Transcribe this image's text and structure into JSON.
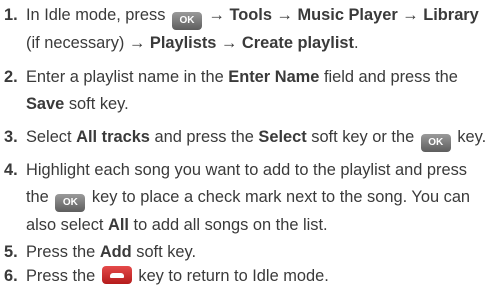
{
  "steps": [
    {
      "number": "1.",
      "parts": {
        "p1": "In Idle mode, press",
        "key": "OK",
        "a1": "→",
        "tools": "Tools",
        "a2": "→",
        "music_player": "Music Player",
        "a3": "→",
        "library": "Library",
        "if_necessary": "(if necessary)",
        "a4": "→",
        "playlists": "Playlists",
        "a5": "→",
        "create_playlist": "Create playlist",
        "end": "."
      }
    },
    {
      "number": "2.",
      "parts": {
        "p1": "Enter a playlist name in the",
        "enter_name": "Enter Name",
        "p2": "field and press the",
        "save": "Save",
        "p3": "soft key."
      }
    },
    {
      "number": "3.",
      "parts": {
        "p1": "Select",
        "all_tracks": "All tracks",
        "p2": "and press the",
        "select": "Select",
        "p3": "soft key or the",
        "key": "OK",
        "p4": "key."
      }
    },
    {
      "number": "4.",
      "parts": {
        "p1": "Highlight each song you want to add to the playlist and press the",
        "key": "OK",
        "p2": "key to place a check mark next to the song. You can also select",
        "all": "All",
        "p3": "to add all songs on the list."
      }
    },
    {
      "number": "5.",
      "parts": {
        "p1": "Press the",
        "add": "Add",
        "p2": "soft key."
      }
    },
    {
      "number": "6.",
      "parts": {
        "p1": "Press the",
        "p2": "key to return to Idle mode."
      }
    }
  ],
  "icons": {
    "ok_key": "ok-key-icon",
    "end_key": "end-key-icon"
  },
  "colors": {
    "text": "#3a3a3a",
    "ok_key": "#6e6e6e",
    "end_key": "#c82525"
  }
}
